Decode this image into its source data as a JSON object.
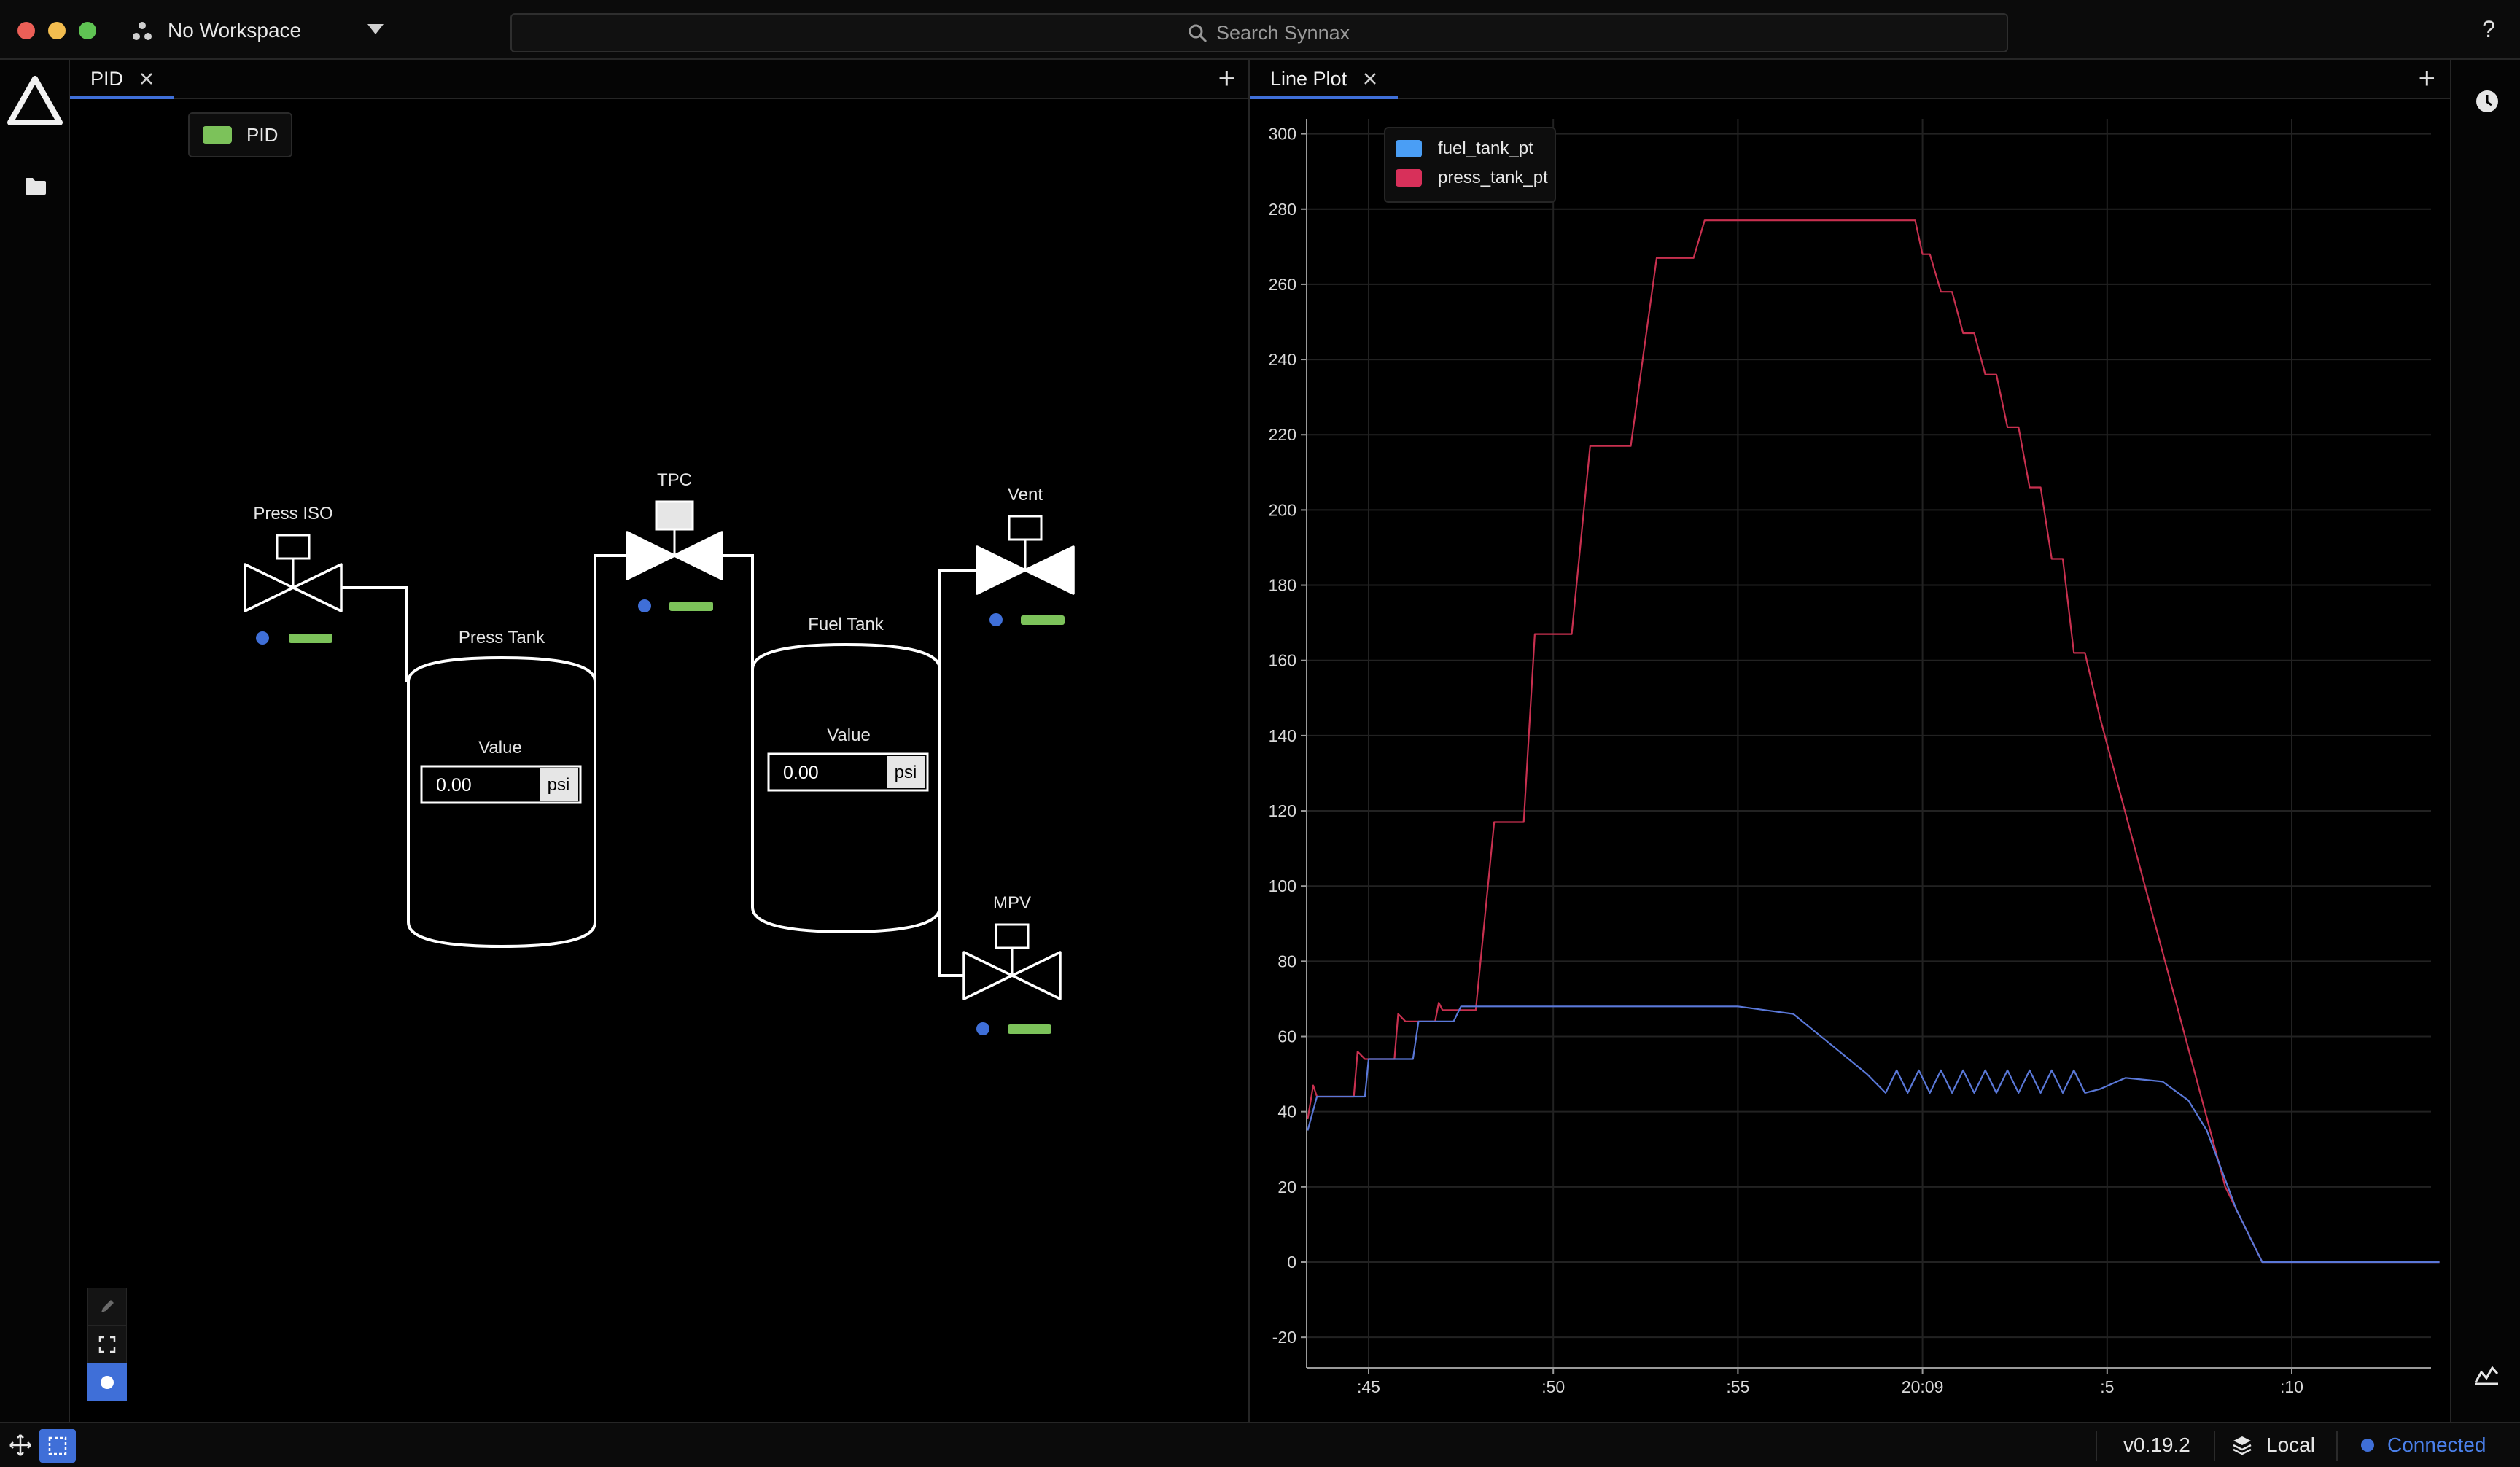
{
  "window": {
    "workspace_label": "No Workspace",
    "search_placeholder": "Search Synnax",
    "help_label": "?"
  },
  "left_pane": {
    "tab_label": "PID",
    "legend_label": "PID",
    "legend_color": "#7cc25a"
  },
  "schematic": {
    "valves": {
      "press_iso": "Press ISO",
      "tpc": "TPC",
      "vent": "Vent",
      "mpv": "MPV"
    },
    "tanks": {
      "press_tank": "Press Tank",
      "fuel_tank": "Fuel Tank"
    },
    "press_tank_value": {
      "label": "Value",
      "value": "0.00",
      "unit": "psi"
    },
    "fuel_tank_value": {
      "label": "Value",
      "value": "0.00",
      "unit": "psi"
    },
    "indicator_dot_color": "#3f6fd8",
    "indicator_bar_color": "#7cc25a"
  },
  "right_pane": {
    "tab_label": "Line Plot"
  },
  "chart_data": {
    "type": "line",
    "title": "",
    "xlabel": "",
    "ylabel": "",
    "ylim": [
      -25,
      303
    ],
    "y_ticks": [
      "300",
      "280",
      "260",
      "240",
      "220",
      "200",
      "180",
      "160",
      "140",
      "120",
      "100",
      "80",
      "60",
      "40",
      "20",
      "0",
      "-20"
    ],
    "x_ticks": [
      ":45",
      ":50",
      ":55",
      "20:09",
      ":5",
      ":10"
    ],
    "x_tick_values": [
      45,
      50,
      55,
      60,
      65,
      70
    ],
    "x_range": [
      43.35,
      74.0
    ],
    "grid": true,
    "legend_position": "top-left",
    "series": [
      {
        "name": "fuel_tank_pt",
        "color": "#4a9ef5",
        "line_color": "#5a78d8",
        "x": [
          43.35,
          43.6,
          44.9,
          45.0,
          46.2,
          46.35,
          47.3,
          47.5,
          50,
          55,
          56.5,
          57.5,
          58.5,
          59.0,
          59.3,
          59.6,
          59.9,
          60.2,
          60.5,
          60.8,
          61.1,
          61.4,
          61.7,
          62.0,
          62.3,
          62.6,
          62.9,
          63.2,
          63.5,
          63.8,
          64.1,
          64.4,
          64.8,
          65.5,
          66.5,
          67.2,
          67.7,
          68.5,
          69.2,
          69.4,
          74.0
        ],
        "values": [
          35,
          44,
          44,
          54,
          54,
          64,
          64,
          68,
          68,
          68,
          66,
          58,
          50,
          45,
          51,
          45,
          51,
          45,
          51,
          45,
          51,
          45,
          51,
          45,
          51,
          45,
          51,
          45,
          51,
          45,
          51,
          45,
          46,
          49,
          48,
          43,
          35,
          14,
          0,
          0,
          0
        ]
      },
      {
        "name": "press_tank_pt",
        "color": "#d8305a",
        "line_color": "#c8304f",
        "x": [
          43.35,
          43.5,
          43.6,
          44.6,
          44.7,
          44.9,
          45.7,
          45.8,
          46.0,
          46.8,
          46.9,
          47.0,
          47.9,
          48.4,
          49.2,
          49.5,
          50.5,
          51.0,
          52.1,
          52.8,
          53.8,
          54.1,
          54.9,
          59.8,
          60.0,
          60.2,
          60.5,
          60.8,
          61.1,
          61.4,
          61.7,
          62.0,
          62.3,
          62.6,
          62.9,
          63.2,
          63.5,
          63.8,
          64.1,
          64.4,
          64.8,
          68.2,
          68.5,
          69.2,
          69.4,
          74.0
        ],
        "values": [
          38,
          47,
          44,
          44,
          56,
          54,
          54,
          66,
          64,
          64,
          69,
          67,
          67,
          117,
          117,
          167,
          167,
          217,
          217,
          267,
          267,
          277,
          277,
          277,
          268,
          268,
          258,
          258,
          247,
          247,
          236,
          236,
          222,
          222,
          206,
          206,
          187,
          187,
          162,
          162,
          145,
          20,
          14,
          0,
          0,
          0
        ]
      }
    ]
  },
  "statusbar": {
    "version": "v0.19.2",
    "cluster": "Local",
    "connection": "Connected",
    "connection_color": "#3f6fd8"
  }
}
